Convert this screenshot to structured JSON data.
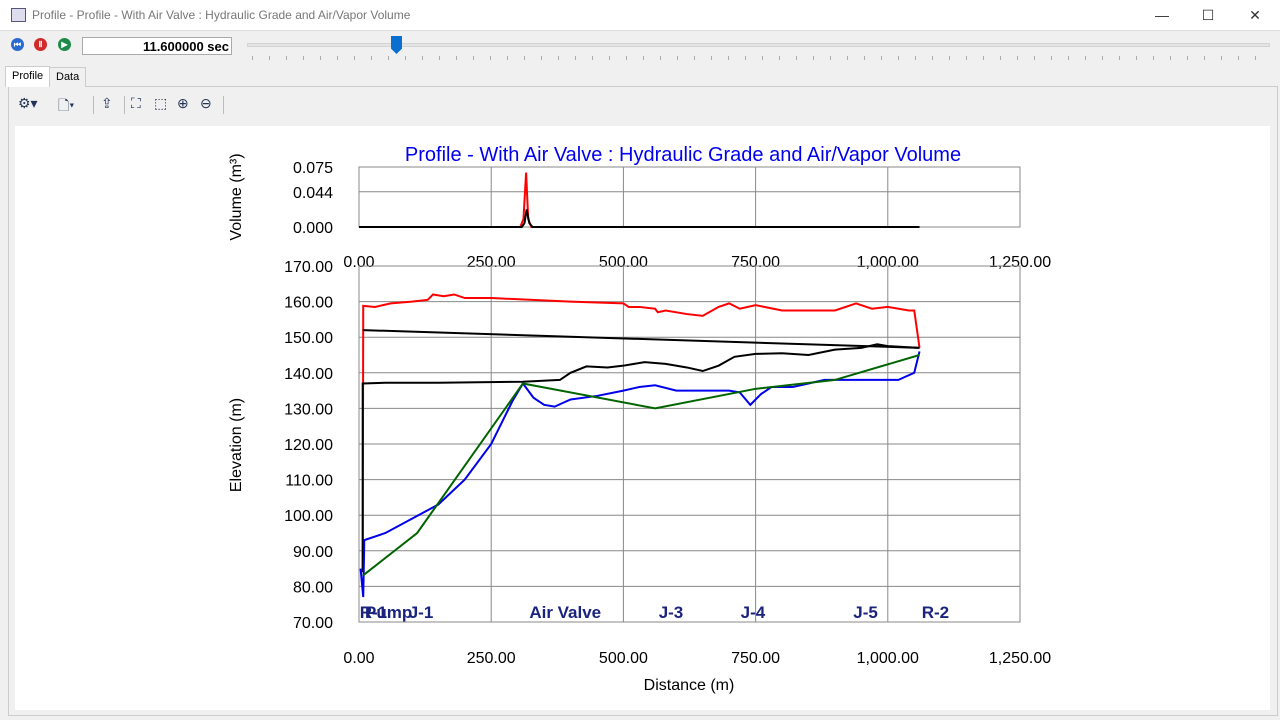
{
  "window": {
    "title": "Profile - Profile - With Air Valve : Hydraulic Grade and Air/Vapor Volume",
    "minimize": "—",
    "maximize": "☐",
    "close": "✕"
  },
  "playback": {
    "time": "11.600000 sec",
    "progress_fraction": 0.147,
    "rewind": "⏮",
    "pause": "Ⅱ",
    "play": "▶"
  },
  "tabs": [
    {
      "label": "Profile",
      "active": true
    },
    {
      "label": "Data",
      "active": false
    }
  ],
  "toolbar": {
    "icons": [
      "chart-settings-icon",
      "print-preview-icon",
      "export-icon",
      "zoom-extents-icon",
      "zoom-window-icon",
      "zoom-in-icon",
      "zoom-out-icon"
    ]
  },
  "chart_data": [
    {
      "type": "line",
      "title": "Profile - With Air Valve : Hydraulic Grade and Air/Vapor Volume",
      "ylabel": "Volume (m³)",
      "xlim": [
        0,
        1250
      ],
      "ylim": [
        0,
        0.075
      ],
      "yticks": [
        "0.075",
        "0.044",
        "0.000"
      ],
      "xticks": [
        "0.00",
        "250.00",
        "500.00",
        "750.00",
        "1,000.00",
        "1,250.00"
      ],
      "series": [
        {
          "name": "air-volume-max",
          "color": "#ff0000",
          "points": [
            [
              0,
              0
            ],
            [
              305,
              0
            ],
            [
              311,
              0.01
            ],
            [
              316,
              0.068
            ],
            [
              320,
              0.01
            ],
            [
              326,
              0
            ],
            [
              1060,
              0
            ]
          ]
        },
        {
          "name": "air-volume-current",
          "color": "#000000",
          "points": [
            [
              0,
              0
            ],
            [
              308,
              0
            ],
            [
              313,
              0.005
            ],
            [
              317,
              0.022
            ],
            [
              322,
              0.005
            ],
            [
              328,
              0
            ],
            [
              1060,
              0
            ]
          ]
        }
      ]
    },
    {
      "type": "line",
      "xlabel": "Distance (m)",
      "ylabel": "Elevation (m)",
      "xlim": [
        0,
        1250
      ],
      "ylim": [
        70,
        170
      ],
      "yticks": [
        "170.00",
        "160.00",
        "150.00",
        "140.00",
        "130.00",
        "120.00",
        "110.00",
        "100.00",
        "90.00",
        "80.00",
        "70.00"
      ],
      "xticks": [
        "0.00",
        "250.00",
        "500.00",
        "750.00",
        "1,000.00",
        "1,250.00"
      ],
      "node_labels": [
        {
          "label": "R-1",
          "x": 7
        },
        {
          "label": "Pump",
          "x": 40
        },
        {
          "label": "J-1",
          "x": 140
        },
        {
          "label": "Air Valve",
          "x": 390
        },
        {
          "label": "J-3",
          "x": 590
        },
        {
          "label": "J-4",
          "x": 745
        },
        {
          "label": "J-5",
          "x": 958
        },
        {
          "label": "R-2",
          "x": 1090
        }
      ],
      "series": [
        {
          "name": "max-hgl",
          "color": "#ff0000",
          "points": [
            [
              7,
              84
            ],
            [
              8,
              158.8
            ],
            [
              30,
              158.5
            ],
            [
              60,
              159.5
            ],
            [
              100,
              160
            ],
            [
              130,
              160.5
            ],
            [
              140,
              162
            ],
            [
              160,
              161.5
            ],
            [
              180,
              162
            ],
            [
              200,
              161
            ],
            [
              250,
              161
            ],
            [
              400,
              160
            ],
            [
              500,
              159.5
            ],
            [
              510,
              158.5
            ],
            [
              530,
              158.5
            ],
            [
              560,
              158
            ],
            [
              565,
              157
            ],
            [
              580,
              157.5
            ],
            [
              620,
              156.5
            ],
            [
              650,
              156
            ],
            [
              680,
              158.5
            ],
            [
              700,
              159.5
            ],
            [
              720,
              158
            ],
            [
              750,
              159
            ],
            [
              800,
              157.5
            ],
            [
              900,
              157.5
            ],
            [
              940,
              159.5
            ],
            [
              970,
              158
            ],
            [
              1000,
              158.5
            ],
            [
              1040,
              157.5
            ],
            [
              1050,
              157.5
            ],
            [
              1060,
              147
            ]
          ]
        },
        {
          "name": "initial-hgl",
          "color": "#000000",
          "points": [
            [
              7,
              152
            ],
            [
              1060,
              147
            ]
          ]
        },
        {
          "name": "current-hgl",
          "color": "#000000",
          "points": [
            [
              7,
              84
            ],
            [
              7,
              137
            ],
            [
              50,
              137.2
            ],
            [
              150,
              137.2
            ],
            [
              310,
              137.5
            ],
            [
              380,
              138
            ],
            [
              400,
              140
            ],
            [
              430,
              141.8
            ],
            [
              470,
              141.5
            ],
            [
              500,
              142
            ],
            [
              540,
              143
            ],
            [
              580,
              142.5
            ],
            [
              620,
              141.5
            ],
            [
              650,
              140.5
            ],
            [
              680,
              142
            ],
            [
              710,
              144.5
            ],
            [
              750,
              145.3
            ],
            [
              800,
              145.5
            ],
            [
              850,
              145
            ],
            [
              900,
              146.5
            ],
            [
              950,
              147
            ],
            [
              980,
              148
            ],
            [
              1000,
              147.5
            ],
            [
              1060,
              147
            ]
          ]
        },
        {
          "name": "min-hgl",
          "color": "#0000ee",
          "points": [
            [
              3,
              85
            ],
            [
              8,
              77
            ],
            [
              10,
              93
            ],
            [
              50,
              95
            ],
            [
              100,
              99
            ],
            [
              150,
              103
            ],
            [
              200,
              110
            ],
            [
              250,
              120
            ],
            [
              290,
              132
            ],
            [
              310,
              137
            ],
            [
              330,
              133
            ],
            [
              350,
              131
            ],
            [
              370,
              130.5
            ],
            [
              400,
              132.5
            ],
            [
              450,
              133.5
            ],
            [
              500,
              135
            ],
            [
              530,
              136
            ],
            [
              560,
              136.5
            ],
            [
              600,
              135
            ],
            [
              700,
              135
            ],
            [
              720,
              134.5
            ],
            [
              740,
              131
            ],
            [
              760,
              134
            ],
            [
              780,
              136
            ],
            [
              820,
              136
            ],
            [
              850,
              137
            ],
            [
              880,
              138
            ],
            [
              1020,
              138
            ],
            [
              1050,
              140
            ],
            [
              1060,
              146
            ]
          ]
        },
        {
          "name": "pipe-elevation",
          "color": "#006400",
          "points": [
            [
              7,
              83
            ],
            [
              110,
              95
            ],
            [
              310,
              137
            ],
            [
              560,
              130
            ],
            [
              750,
              135.5
            ],
            [
              900,
              138
            ],
            [
              1060,
              145
            ]
          ]
        }
      ]
    }
  ]
}
